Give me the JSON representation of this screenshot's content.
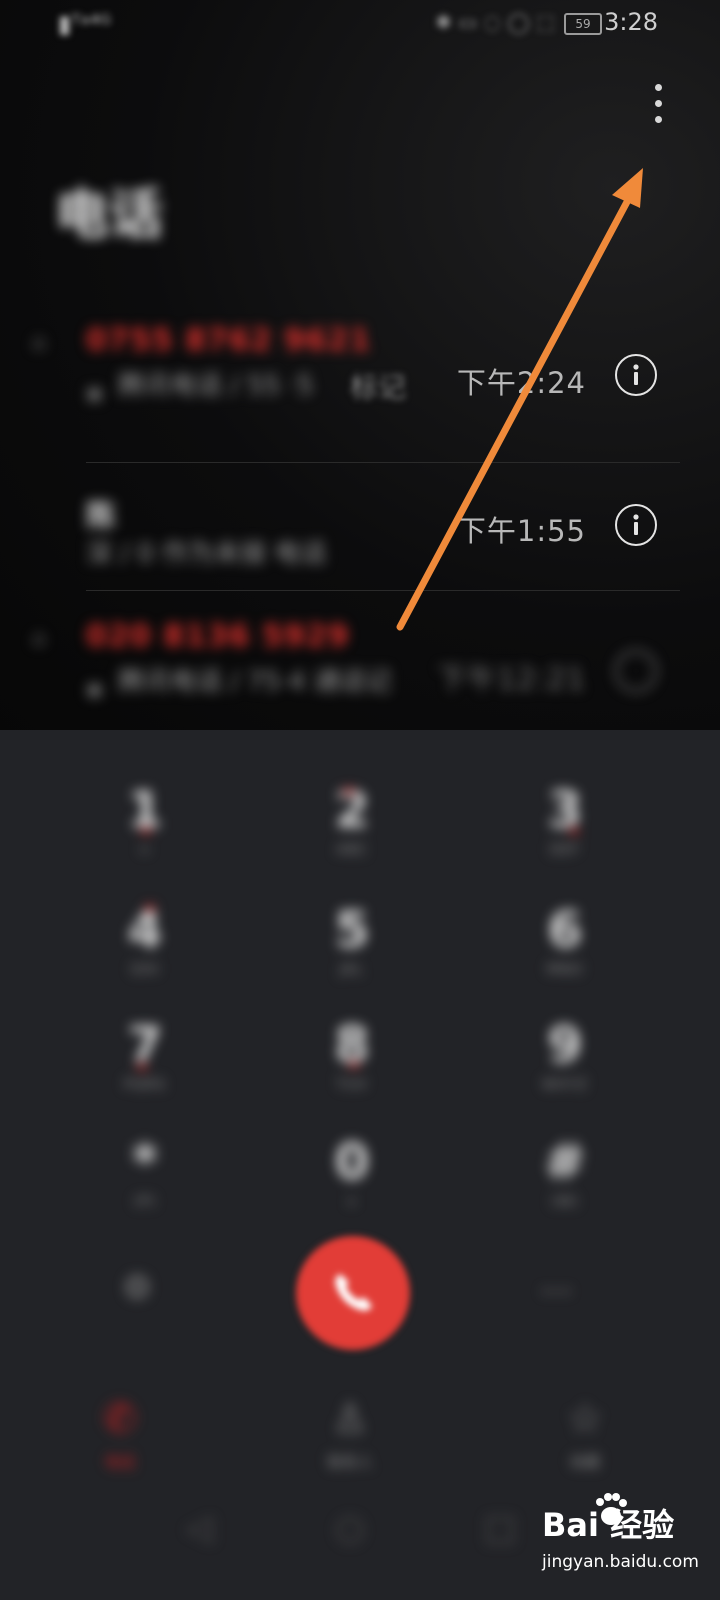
{
  "status_bar": {
    "time": "3:28",
    "battery": "59",
    "left_text": "▮ᵀᵃ⁴ᴳ",
    "right_icons": "✱ ▭ ◌ ◯ ⬚"
  },
  "header": {
    "title": "电话",
    "more_icon": "more-vertical-icon"
  },
  "call_log": [
    {
      "number": "0755 8762 9621",
      "missed": true,
      "location": "腾讯电话 / 55 ·5",
      "tag": "标记",
      "time": "下午2:24"
    },
    {
      "number": "陈",
      "missed": false,
      "location": "深 / 0 作为未接 电话",
      "tag": "",
      "time": "下午1:55"
    },
    {
      "number": "020 8136 5929",
      "missed": true,
      "location": "腾讯电话 / 75·4 通话记",
      "tag": "",
      "time": "下午12:21"
    }
  ],
  "dialpad": {
    "keys": [
      {
        "digit": "1",
        "letters": "∞"
      },
      {
        "digit": "2",
        "letters": "ABC"
      },
      {
        "digit": "3",
        "letters": "DEF"
      },
      {
        "digit": "4",
        "letters": "GHI"
      },
      {
        "digit": "5",
        "letters": "JKL"
      },
      {
        "digit": "6",
        "letters": "MNO"
      },
      {
        "digit": "7",
        "letters": "PQRS"
      },
      {
        "digit": "8",
        "letters": "TUV"
      },
      {
        "digit": "9",
        "letters": "WXYZ"
      },
      {
        "digit": "*",
        "letters": "(P)"
      },
      {
        "digit": "0",
        "letters": "+"
      },
      {
        "digit": "#",
        "letters": "(W)"
      }
    ],
    "left_button": "⚙",
    "right_button": "···"
  },
  "bottom_tabs": [
    {
      "label": "电话",
      "icon": "phone-icon",
      "active": true
    },
    {
      "label": "联系人",
      "icon": "contacts-icon",
      "active": false
    },
    {
      "label": "收藏",
      "icon": "star-icon",
      "active": false
    }
  ],
  "nav_bar": {
    "back": "◁",
    "home": "○",
    "recent": "□"
  },
  "watermark": {
    "brand": "Bai  经验",
    "url": "jingyan.baidu.com"
  },
  "colors": {
    "accent_red": "#e23d37",
    "arrow": "#f08a3a",
    "panel": "#222327"
  }
}
